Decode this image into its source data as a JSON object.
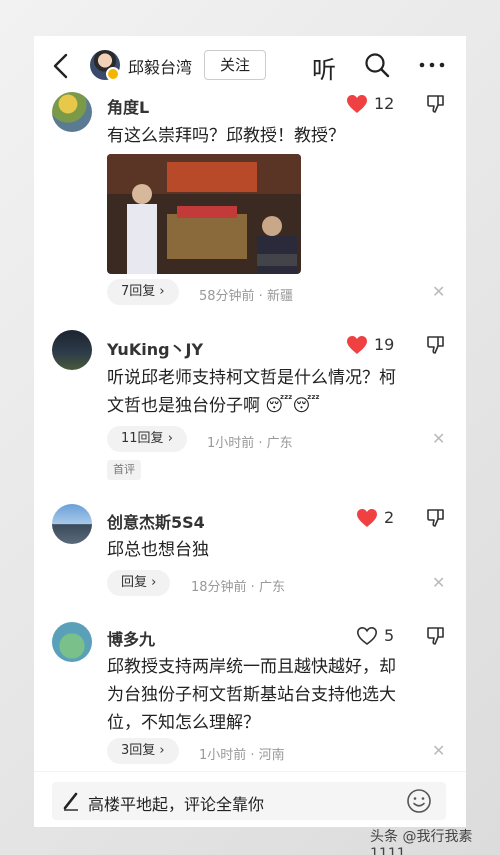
{
  "header": {
    "author": "邱毅台湾",
    "follow_label": "关注",
    "listen_label": "听"
  },
  "comments": [
    {
      "name": "角度L",
      "likes": "12",
      "liked": true,
      "text": "有这么崇拜吗？邱教授！教授？",
      "replies": "7回复",
      "meta": "58分钟前 · 新疆"
    },
    {
      "name": "YuKing丶JY",
      "likes": "19",
      "liked": true,
      "text_line1": "听说邱老师支持柯文哲是什么情况？柯",
      "text_line2": "文哲也是独台份子啊",
      "replies": "11回复",
      "meta": "1小时前 · 广东",
      "tag": "首评"
    },
    {
      "name": "创意杰斯5S4",
      "likes": "2",
      "liked": true,
      "text": "邱总也想台独",
      "replies": "回复",
      "meta": "18分钟前 · 广东"
    },
    {
      "name": "博多九",
      "likes": "5",
      "liked": false,
      "text_line1": "邱教授支持两岸统一而且越快越好，却",
      "text_line2": "为台独份子柯文哲斯基站台支持他选大",
      "text_line3": "位，不知怎么理解？",
      "replies": "3回复",
      "meta": "1小时前 · 河南"
    }
  ],
  "footer": {
    "placeholder": "高楼平地起，评论全靠你"
  },
  "watermark": "头条 @我行我素1111",
  "colors": {
    "like_red": "#f04142",
    "muted": "#999999"
  }
}
